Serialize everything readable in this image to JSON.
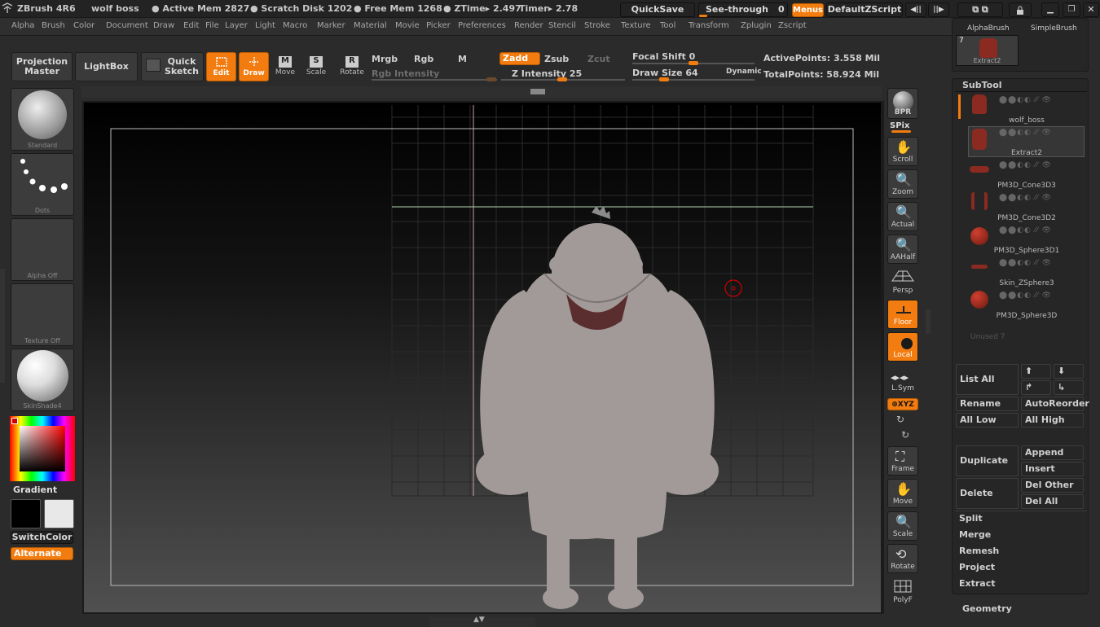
{
  "app": {
    "name": "ZBrush 4R6",
    "doc": "wolf boss",
    "active_mem": "● Active Mem 2827",
    "scratch": "● Scratch Disk 1202",
    "free_mem": "● Free Mem 1268",
    "ztime": "● ZTime▸ 2.497",
    "timer": "Timer▸ 2.78"
  },
  "titlebar": {
    "quicksave": "QuickSave",
    "seethrough": "See-through",
    "seethrough_val": "0",
    "menus": "Menus",
    "script": "DefaultZScript"
  },
  "menus": [
    "Alpha",
    "Brush",
    "Color",
    "Document",
    "Draw",
    "Edit",
    "File",
    "Layer",
    "Light",
    "Macro",
    "Marker",
    "Material",
    "Movie",
    "Picker",
    "Preferences",
    "Render",
    "Stencil",
    "Stroke",
    "Texture",
    "Tool",
    "Transform",
    "Zplugin",
    "Zscript"
  ],
  "toolbar": {
    "projection_master": "Projection Master",
    "lightbox": "LightBox",
    "quick_sketch": "Quick Sketch",
    "edit": "Edit",
    "draw": "Draw",
    "move": "Move",
    "scale": "Scale",
    "rotate": "Rotate",
    "mrgb": "Mrgb",
    "rgb": "Rgb",
    "m": "M",
    "rgb_intensity": "Rgb Intensity",
    "zadd": "Zadd",
    "zsub": "Zsub",
    "zcut": "Zcut",
    "z_intensity": "Z Intensity 25",
    "focal_shift": "Focal Shift",
    "focal_val": "0",
    "draw_size": "Draw Size 64",
    "dynamic": "Dynamic",
    "active_points": "ActivePoints: 3.558 Mil",
    "total_points": "TotalPoints: 58.924 Mil"
  },
  "shelf": {
    "brush": "Standard",
    "stroke": "Dots",
    "alpha": "Alpha Off",
    "texture": "Texture Off",
    "material": "SkinShade4",
    "gradient": "Gradient",
    "switch_color": "SwitchColor",
    "alternate": "Alternate"
  },
  "right_dock": {
    "bpr": "BPR",
    "spix": "SPix",
    "scroll": "Scroll",
    "zoom": "Zoom",
    "actual": "Actual",
    "aahalf": "AAHalf",
    "persp": "Persp",
    "floor": "Floor",
    "local": "Local",
    "lsym": "L.Sym",
    "xyz": "⊕XYZ",
    "frame": "Frame",
    "move": "Move",
    "scale": "Scale",
    "rotate": "Rotate",
    "polyf": "PolyF"
  },
  "tool_tray": {
    "alpha_brush": "AlphaBrush",
    "simple_brush": "SimpleBrush",
    "extract_count": "7",
    "extract": "Extract2"
  },
  "subtool": {
    "title": "SubTool",
    "items": [
      {
        "name": "wolf_boss"
      },
      {
        "name": "Extract2"
      },
      {
        "name": "PM3D_Cone3D3"
      },
      {
        "name": "PM3D_Cone3D2"
      },
      {
        "name": "PM3D_Sphere3D1"
      },
      {
        "name": "Skin_ZSphere3"
      },
      {
        "name": "PM3D_Sphere3D"
      }
    ],
    "unused": "Unused 7",
    "list_all": "List All",
    "rename": "Rename",
    "auto_reorder": "AutoReorder",
    "all_low": "All Low",
    "all_high": "All High",
    "duplicate": "Duplicate",
    "append": "Append",
    "insert": "Insert",
    "delete": "Delete",
    "del_other": "Del Other",
    "del_all": "Del All",
    "split": "Split",
    "merge": "Merge",
    "remesh": "Remesh",
    "project": "Project",
    "extract": "Extract",
    "geometry": "Geometry"
  },
  "colors": {
    "accent": "#f27c0f",
    "panel": "#2b2b2b"
  }
}
